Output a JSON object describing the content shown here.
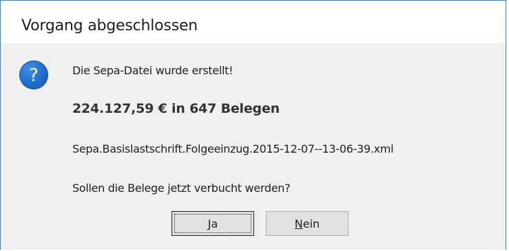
{
  "dialog": {
    "title": "Vorgang abgeschlossen",
    "icon": "question-icon",
    "icon_glyph": "?",
    "icon_color": "#1f6cc8",
    "line1": "Die Sepa-Datei wurde erstellt!",
    "line2": "224.127,59 € in 647 Belegen",
    "line3": "Sepa.Basislastschrift.Folgeeinzug.2015-12-07--13-06-39.xml",
    "line4": "Sollen die Belege jetzt verbucht werden?"
  },
  "buttons": {
    "yes_mnemonic": "J",
    "yes_rest": "a",
    "no_mnemonic": "N",
    "no_rest": "ein"
  }
}
